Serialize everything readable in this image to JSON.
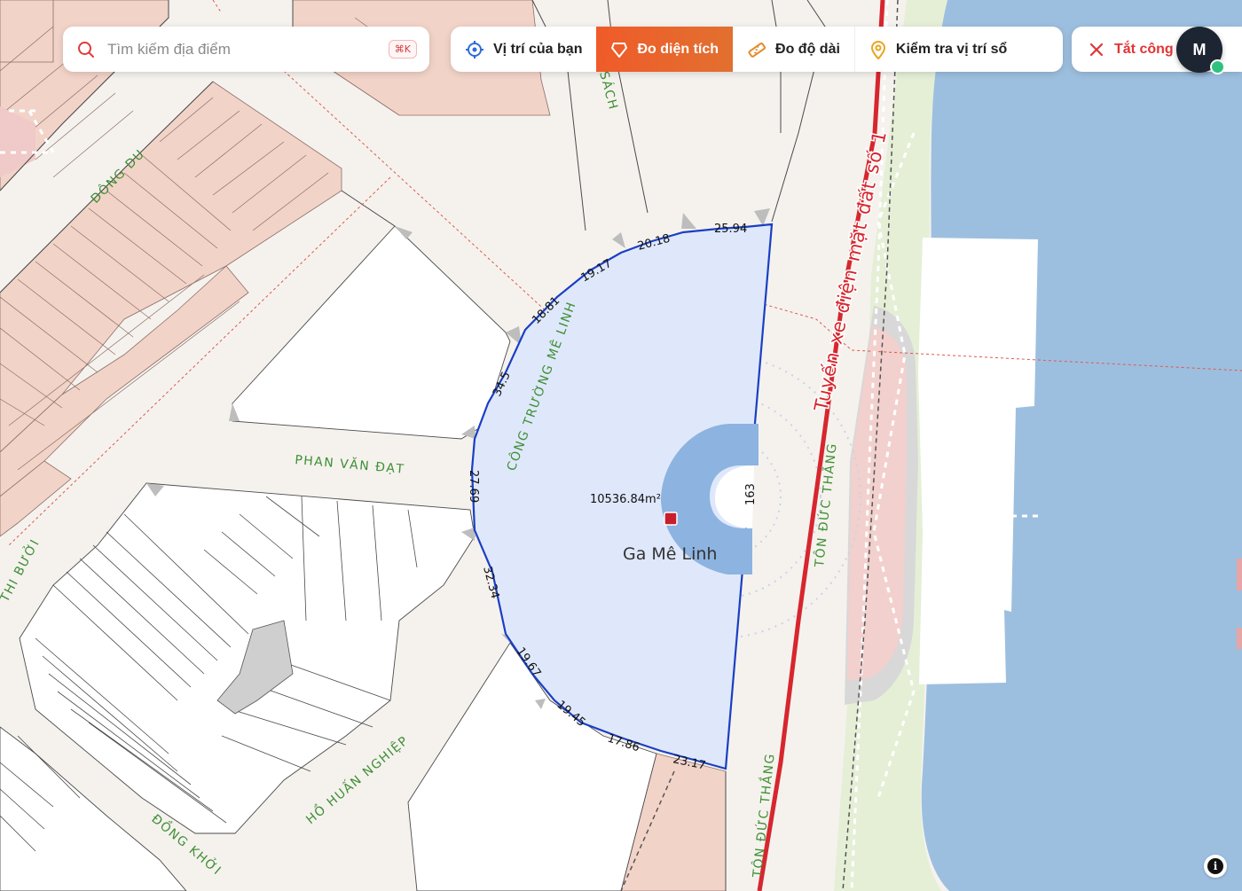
{
  "search": {
    "placeholder": "Tìm kiếm địa điểm",
    "shortcut": "⌘K"
  },
  "toolbar": {
    "your_location": "Vị trí của bạn",
    "measure_area": "Đo diện tích",
    "measure_length": "Đo độ dài",
    "check_location": "Kiểm tra vị trí sổ",
    "turn_off": "Tắt công"
  },
  "user": {
    "initial": "M",
    "status": "online"
  },
  "colors": {
    "accent": "#ef5b2a",
    "measurement_outline": "#1a3fc4",
    "measurement_fill": "#dfe8fb",
    "water": "#9dbfdf",
    "parcel": "#f2d3c8",
    "metro_line": "#d7262e"
  },
  "map": {
    "streets": {
      "dong_du": "ĐÔNG DU",
      "sach": "SÁCH",
      "cong_truong_me_linh": "CÔNG TRƯỜNG MÊ LINH",
      "phan_van_dat": "PHAN VĂN ĐẠT",
      "thi_buoi": "THI BƯỞI",
      "ho_huan_nghiep": "HỒ HUẤN NGHIỆP",
      "dong_khoi": "ĐỒNG KHỞI",
      "ton_duc_thang_1": "TÔN ĐỨC THẮNG",
      "ton_duc_thang_2": "TÔN ĐỨC THẮNG"
    },
    "metro_label": "Tuyến xe điện mặt đất số 1",
    "station_name": "Ga Mê Linh",
    "area": "10536.84m²",
    "segments": [
      "25.94",
      "20.18",
      "19.17",
      "18.81",
      "34.5",
      "27.69",
      "32.34",
      "19.67",
      "19.45",
      "17.86",
      "23.17",
      "163"
    ]
  },
  "info_icon": "i"
}
